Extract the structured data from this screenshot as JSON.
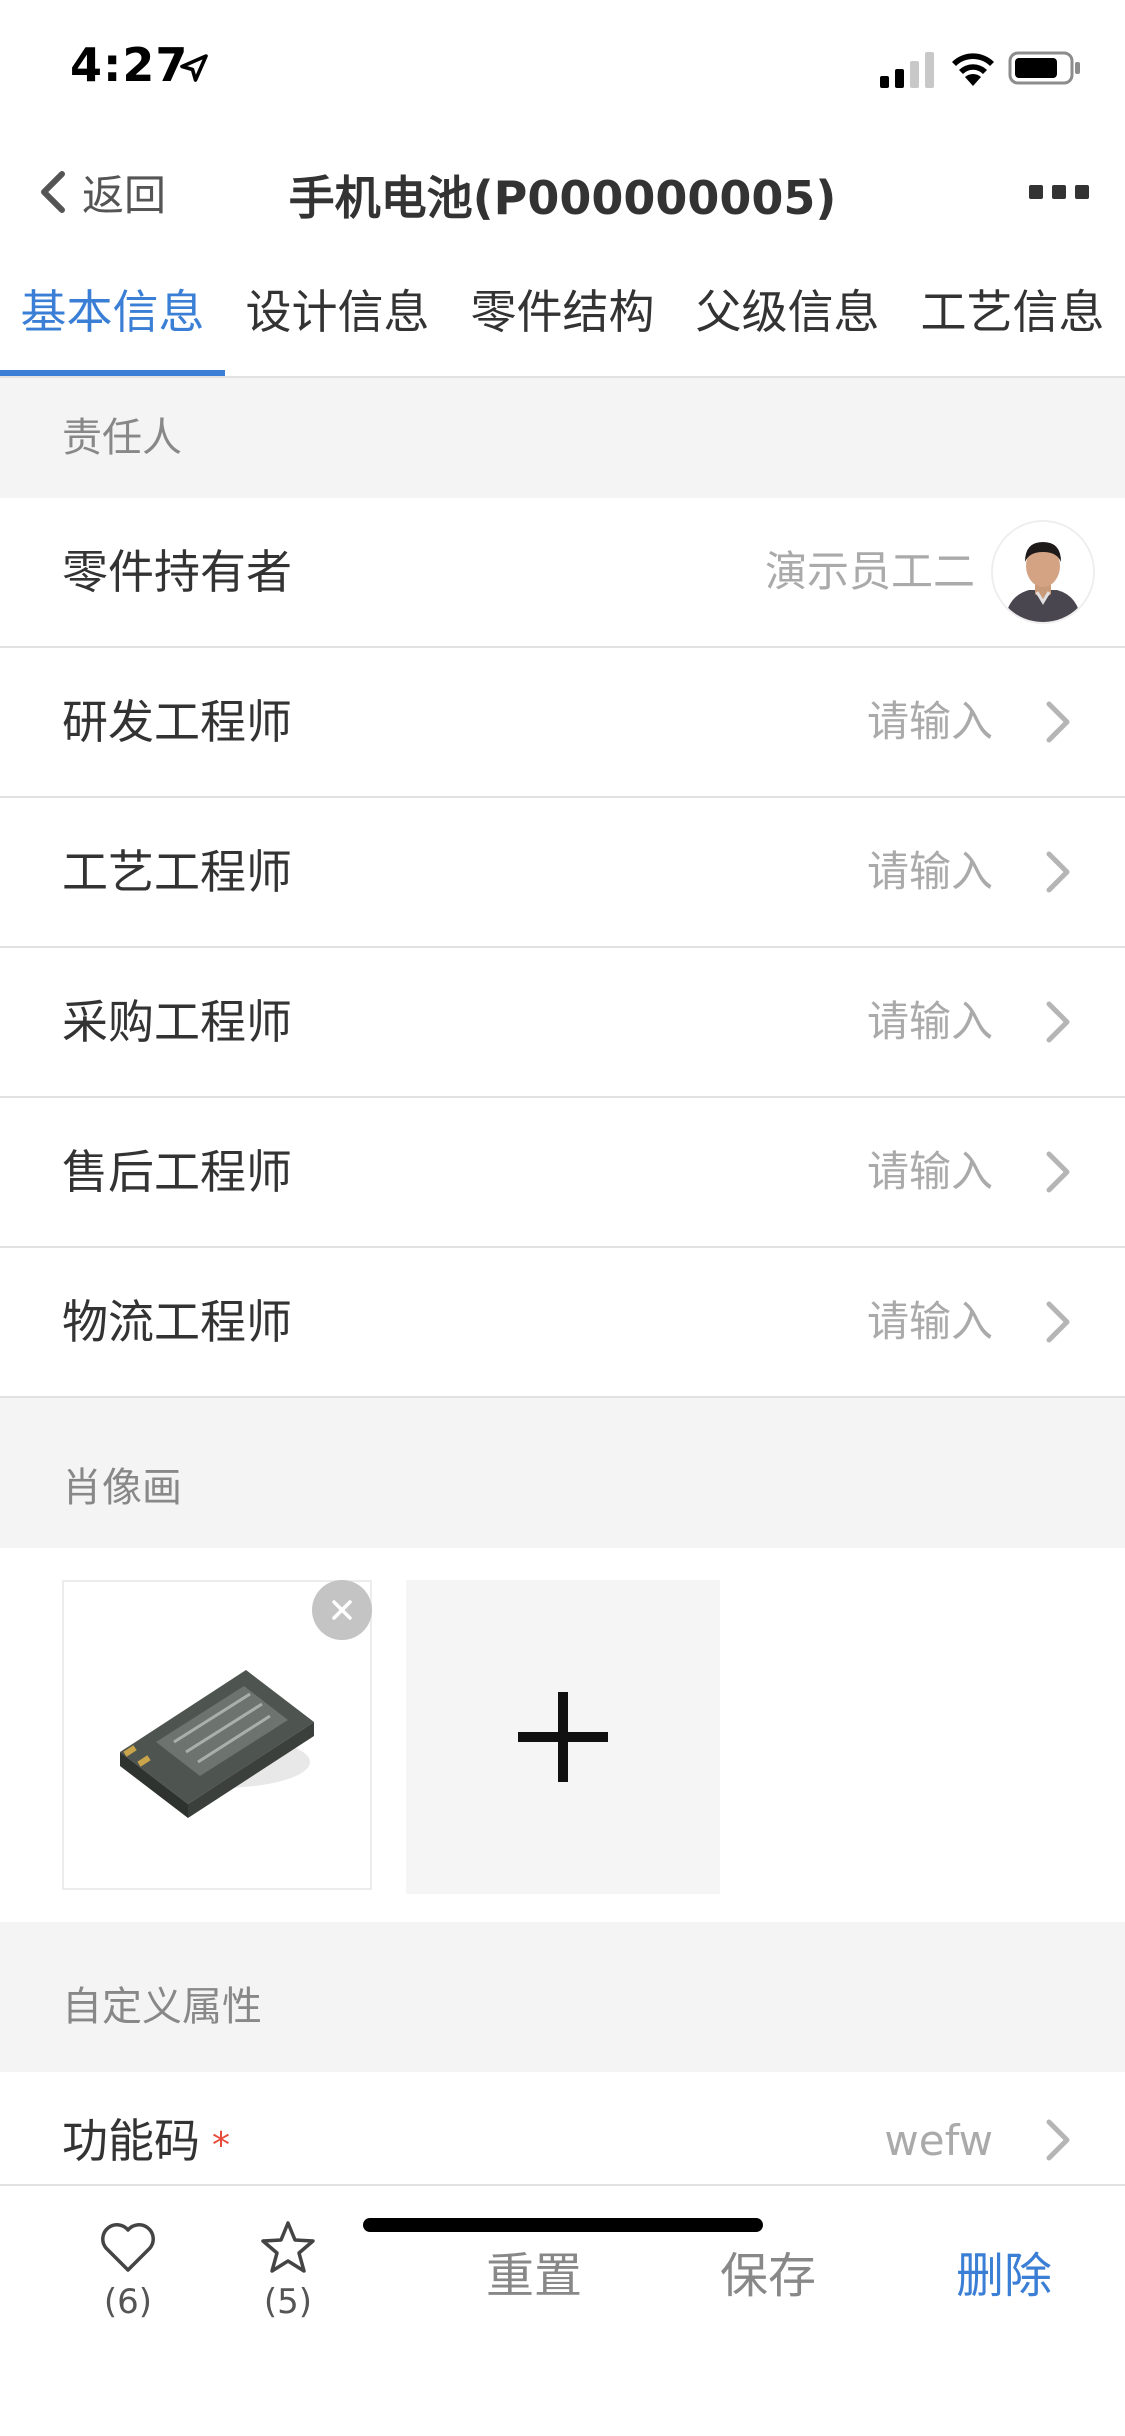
{
  "status_bar": {
    "time": "4:27"
  },
  "nav": {
    "back_label": "返回",
    "title": "手机电池(P000000005)"
  },
  "tabs": [
    {
      "label": "基本信息",
      "active": true
    },
    {
      "label": "设计信息",
      "active": false
    },
    {
      "label": "零件结构",
      "active": false
    },
    {
      "label": "父级信息",
      "active": false
    },
    {
      "label": "工艺信息",
      "active": false
    }
  ],
  "sections": {
    "responsible": {
      "title": "责任人",
      "rows": [
        {
          "label": "零件持有者",
          "value": "演示员工二"
        },
        {
          "label": "研发工程师",
          "value": "请输入"
        },
        {
          "label": "工艺工程师",
          "value": "请输入"
        },
        {
          "label": "采购工程师",
          "value": "请输入"
        },
        {
          "label": "售后工程师",
          "value": "请输入"
        },
        {
          "label": "物流工程师",
          "value": "请输入"
        }
      ]
    },
    "portrait": {
      "title": "肖像画"
    },
    "custom": {
      "title": "自定义属性",
      "rows": [
        {
          "label": "功能码",
          "required_mark": "*",
          "value": "wefw"
        }
      ]
    }
  },
  "bottom_bar": {
    "like_count": "(6)",
    "favorite_count": "(5)",
    "reset_label": "重置",
    "save_label": "保存",
    "delete_label": "删除"
  },
  "colors": {
    "accent": "#3a7fd5",
    "section_bg": "#f4f4f4",
    "required": "#e84a3a"
  },
  "icons": {
    "location": "location-arrow-icon",
    "signal": "cellular-signal-icon",
    "wifi": "wifi-icon",
    "battery": "battery-icon",
    "back": "chevron-left-icon",
    "more": "more-dots-icon",
    "chevron": "chevron-right-icon",
    "remove": "close-icon",
    "add": "plus-icon",
    "like": "heart-icon",
    "favorite": "star-icon"
  }
}
